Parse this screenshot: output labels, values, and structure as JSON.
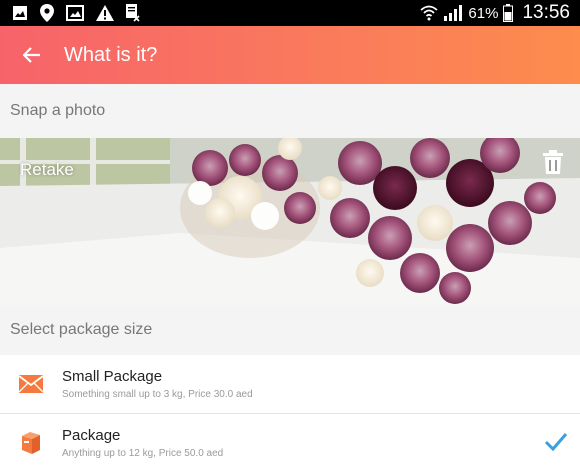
{
  "status_bar": {
    "battery": "61%",
    "time": "13:56",
    "icons": [
      "gallery-icon",
      "location-icon",
      "image-icon",
      "warning-icon",
      "document-icon",
      "wifi-icon",
      "signal-icon",
      "battery-icon"
    ]
  },
  "app_bar": {
    "title": "What is it?",
    "back_icon": "arrow-back-icon"
  },
  "photo_section": {
    "header": "Snap a photo",
    "retake_label": "Retake",
    "delete_icon": "trash-icon"
  },
  "package_section": {
    "header": "Select package size",
    "items": [
      {
        "title": "Small Package",
        "subtitle": "Something small up to 3 kg, Price 30.0 aed",
        "icon": "envelope-icon",
        "selected": false
      },
      {
        "title": "Package",
        "subtitle": "Anything up to 12 kg, Price 50.0 aed",
        "icon": "box-icon",
        "selected": true
      }
    ]
  },
  "colors": {
    "app_bar_start": "#f7636a",
    "app_bar_end": "#fd8c4d",
    "icon_orange": "#f57a3f",
    "check_blue": "#3c9fe0"
  }
}
